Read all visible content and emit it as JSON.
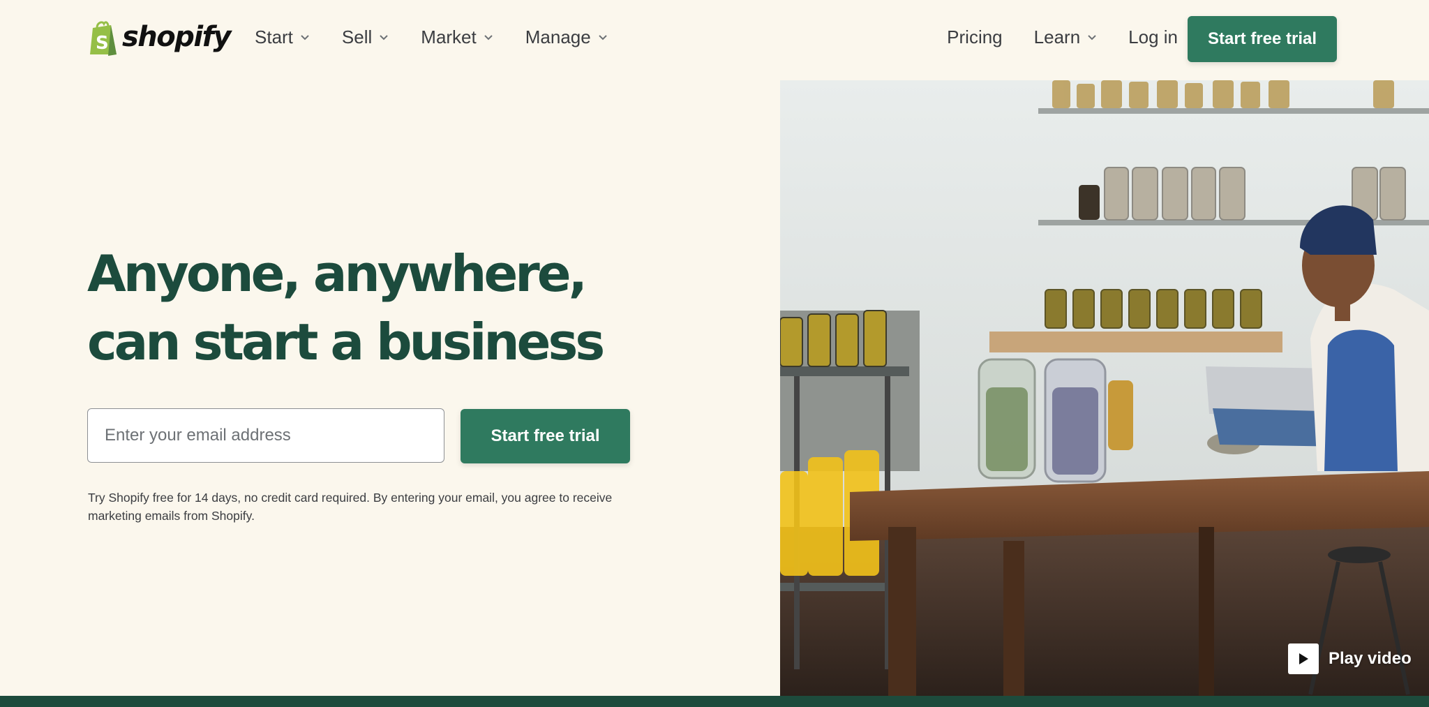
{
  "brand": {
    "name": "shopify",
    "accent": "#2f7a5f",
    "headline_color": "#1c4b3d",
    "background": "#fbf7ed"
  },
  "nav": {
    "left": [
      {
        "label": "Start",
        "has_dropdown": true
      },
      {
        "label": "Sell",
        "has_dropdown": true
      },
      {
        "label": "Market",
        "has_dropdown": true
      },
      {
        "label": "Manage",
        "has_dropdown": true
      }
    ],
    "right": {
      "pricing": "Pricing",
      "learn": "Learn",
      "login": "Log in",
      "cta": "Start free trial"
    }
  },
  "hero": {
    "headline": "Anyone, anywhere, can start a business",
    "email_placeholder": "Enter your email address",
    "cta": "Start free trial",
    "disclaimer": "Try Shopify free for 14 days, no credit card required. By entering your email, you agree to receive marketing emails from Shopify."
  },
  "media": {
    "play_label": "Play video",
    "icons": [
      "shopify-bag-icon",
      "chevron-down-icon",
      "play-icon"
    ]
  }
}
